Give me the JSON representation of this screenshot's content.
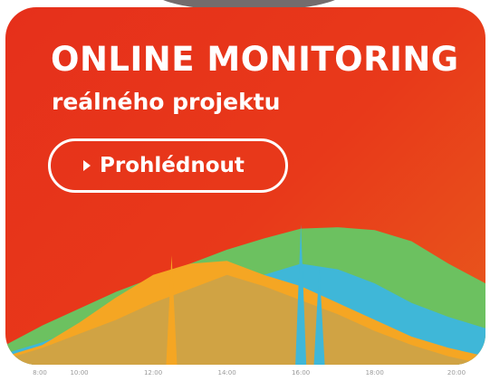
{
  "banner": {
    "headline": "ONLINE MONITORING",
    "subline": "reálného projektu",
    "cta_label": "Prohlédnout",
    "icons": {
      "cta": "play-triangle-icon"
    }
  },
  "chart_data": {
    "type": "area",
    "x": [
      8,
      9,
      10,
      11,
      12,
      13,
      14,
      15,
      16,
      17,
      18,
      19,
      20,
      21
    ],
    "x_ticks": [
      "8:00",
      "10:00",
      "12:00",
      "14:00",
      "16:00",
      "18:00",
      "20:00"
    ],
    "xlim": [
      8,
      21
    ],
    "ylim": [
      0,
      100
    ],
    "series": [
      {
        "color": "#6cc160",
        "values": [
          14,
          28,
          40,
          52,
          62,
          72,
          82,
          90,
          97,
          98,
          96,
          88,
          72,
          58
        ]
      },
      {
        "color": "#3fb7d8",
        "values": [
          8,
          16,
          26,
          36,
          40,
          48,
          58,
          64,
          72,
          68,
          58,
          44,
          34,
          26
        ]
      },
      {
        "color": "#f5a623",
        "values": [
          6,
          14,
          30,
          48,
          64,
          72,
          74,
          64,
          56,
          44,
          32,
          20,
          12,
          6
        ]
      },
      {
        "color": "#c9a24a",
        "values": [
          4,
          12,
          22,
          32,
          44,
          54,
          64,
          56,
          46,
          36,
          24,
          14,
          6,
          0
        ]
      }
    ],
    "spikes": [
      {
        "series": 1,
        "x": 16,
        "value": 100
      },
      {
        "series": 1,
        "x": 16.5,
        "value": 70
      },
      {
        "series": 2,
        "x": 12.5,
        "value": 78
      }
    ],
    "grid": false,
    "legend": "none"
  },
  "colors": {
    "banner_start": "#e6301b",
    "banner_end": "#e85a1c",
    "text": "#ffffff",
    "tick_text": "#9a9a9a"
  }
}
